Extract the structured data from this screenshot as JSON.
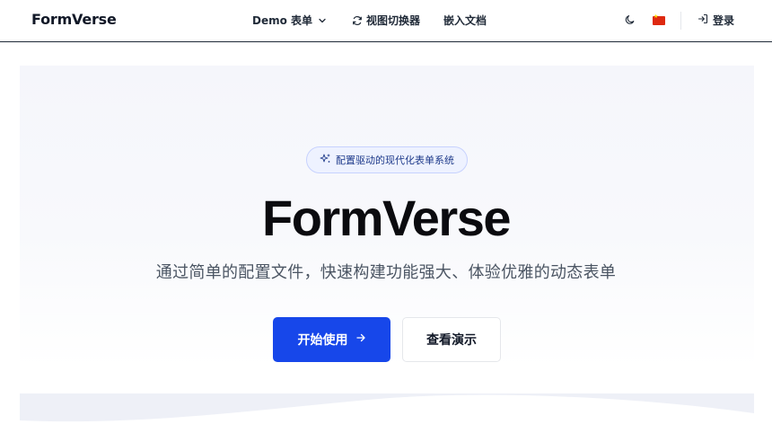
{
  "app": {
    "brand": "FormVerse"
  },
  "nav": {
    "links": [
      {
        "label": "Demo 表单",
        "icon": "chevron-down-icon"
      },
      {
        "label": "视图切换器",
        "icon": "refresh-icon"
      },
      {
        "label": "嵌入文档"
      }
    ],
    "theme_icon": "moon-icon",
    "language_flag": "china-flag-icon",
    "login_label": "登录",
    "login_icon": "login-icon"
  },
  "hero": {
    "badge_text": "配置驱动的现代化表单系统",
    "badge_icon": "sparkles-icon",
    "title": "FormVerse",
    "subtitle": "通过简单的配置文件，快速构建功能强大、体验优雅的动态表单",
    "primary_button": "开始使用",
    "primary_button_icon": "arrow-right-icon",
    "secondary_button": "查看演示"
  },
  "colors": {
    "accent": "#1747ea",
    "badge_bg": "#eef2ff",
    "badge_border": "#c7d2fe"
  }
}
